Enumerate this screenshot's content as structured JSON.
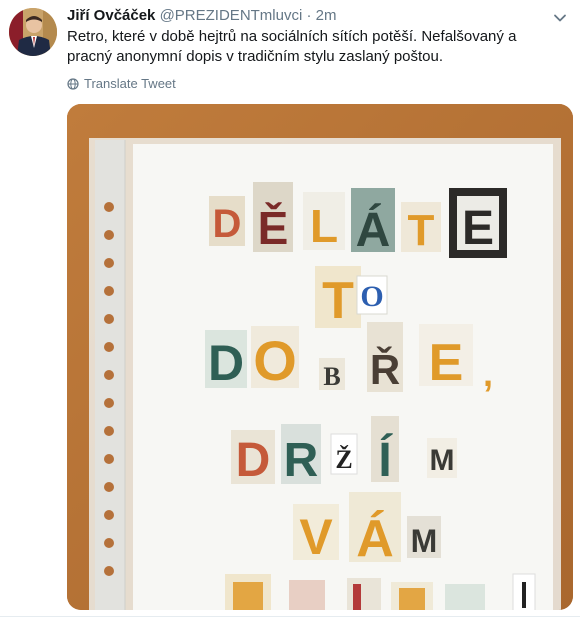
{
  "tweet": {
    "author_name": "Jiří Ovčáček",
    "handle": "@PREZIDENTmluvci",
    "separator": "·",
    "time": "2m",
    "text": "Retro, které v době hejtrů na sociálních sítích potěší. Nefalšovaný a pracný anonymní dopis v tradičním stylu zaslaný poštou.",
    "translate_label": "Translate Tweet"
  },
  "photo": {
    "letters": {
      "line1": [
        "D",
        "Ě",
        "L",
        "Á",
        "T",
        "E"
      ],
      "line2": [
        "T",
        "O"
      ],
      "line3": [
        "D",
        "O",
        "B",
        "Ř",
        "E",
        ","
      ],
      "line4": [
        "D",
        "R",
        "Ž",
        "Í",
        "M"
      ],
      "line5": [
        "V",
        "Á",
        "M"
      ]
    }
  },
  "colors": {
    "name": "#14171a",
    "meta": "#657786",
    "link": "#1da1f2",
    "table_wood": "#b8763b",
    "paper": "#f7f7f4"
  }
}
